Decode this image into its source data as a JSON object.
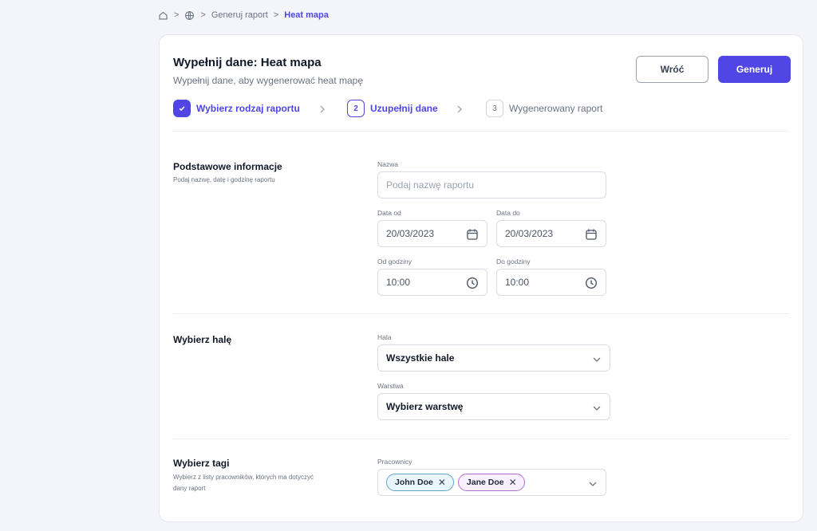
{
  "breadcrumb": {
    "items": [
      "Generuj raport",
      "Heat mapa"
    ]
  },
  "header": {
    "title": "Wypełnij dane: Heat mapa",
    "subtitle": "Wypełnij dane, aby wygenerować heat mapę",
    "back_label": "Wróć",
    "generate_label": "Generuj"
  },
  "stepper": {
    "steps": [
      {
        "number": "",
        "label": "Wybierz rodzaj raportu",
        "status": "done"
      },
      {
        "number": "2",
        "label": "Uzupełnij dane",
        "status": "active"
      },
      {
        "number": "3",
        "label": "Wygenerowany raport",
        "status": "pending"
      }
    ]
  },
  "basic": {
    "title": "Podstawowe informacje",
    "description": "Podaj nazwę, datę i godzinę raportu",
    "name_label": "Nazwa",
    "name_placeholder": "Podaj nazwę raportu",
    "date_from_label": "Data od",
    "date_from_value": "20/03/2023",
    "date_to_label": "Data do",
    "date_to_value": "20/03/2023",
    "time_from_label": "Od godziny",
    "time_from_value": "10:00",
    "time_to_label": "Do godziny",
    "time_to_value": "10:00"
  },
  "hall": {
    "title": "Wybierz halę",
    "hall_label": "Hala",
    "hall_value": "Wszystkie hale",
    "layer_label": "Warstwa",
    "layer_value": "Wybierz warstwę"
  },
  "tags": {
    "title": "Wybierz tagi",
    "description": "Wybierz z listy pracowników, których ma dotyczyć dany raport",
    "workers_label": "Pracownicy",
    "selected": [
      "John Doe",
      "Jane Doe"
    ]
  },
  "colors": {
    "accent": "#4f46e5",
    "background": "#f3f5fb"
  }
}
